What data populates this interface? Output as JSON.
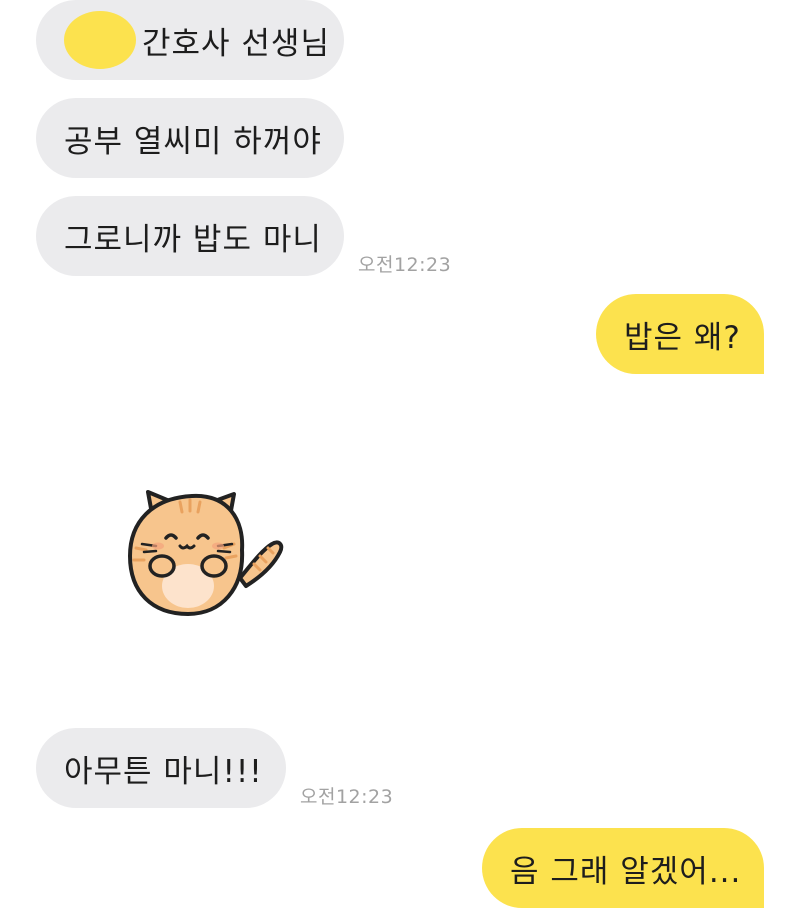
{
  "messages": [
    {
      "side": "in",
      "text": "간호사 선생님",
      "has_redaction": true
    },
    {
      "side": "in",
      "text": "공부 열씨미 하꺼야"
    },
    {
      "side": "in",
      "text": "그로니까 밥도 마니",
      "time": "오전12:23"
    },
    {
      "side": "out",
      "text": "밥은 왜?"
    },
    {
      "side": "in",
      "sticker": "cat-sticker"
    },
    {
      "side": "in",
      "text": "아무튼 마니!!!",
      "time": "오전12:23"
    },
    {
      "side": "out",
      "text": "음 그래 알겠어..."
    }
  ],
  "colors": {
    "incoming_bubble": "#ebebed",
    "outgoing_bubble": "#fce24e",
    "redaction": "#fce24e",
    "timestamp": "#a2a2a2",
    "background": "#ffffff"
  }
}
